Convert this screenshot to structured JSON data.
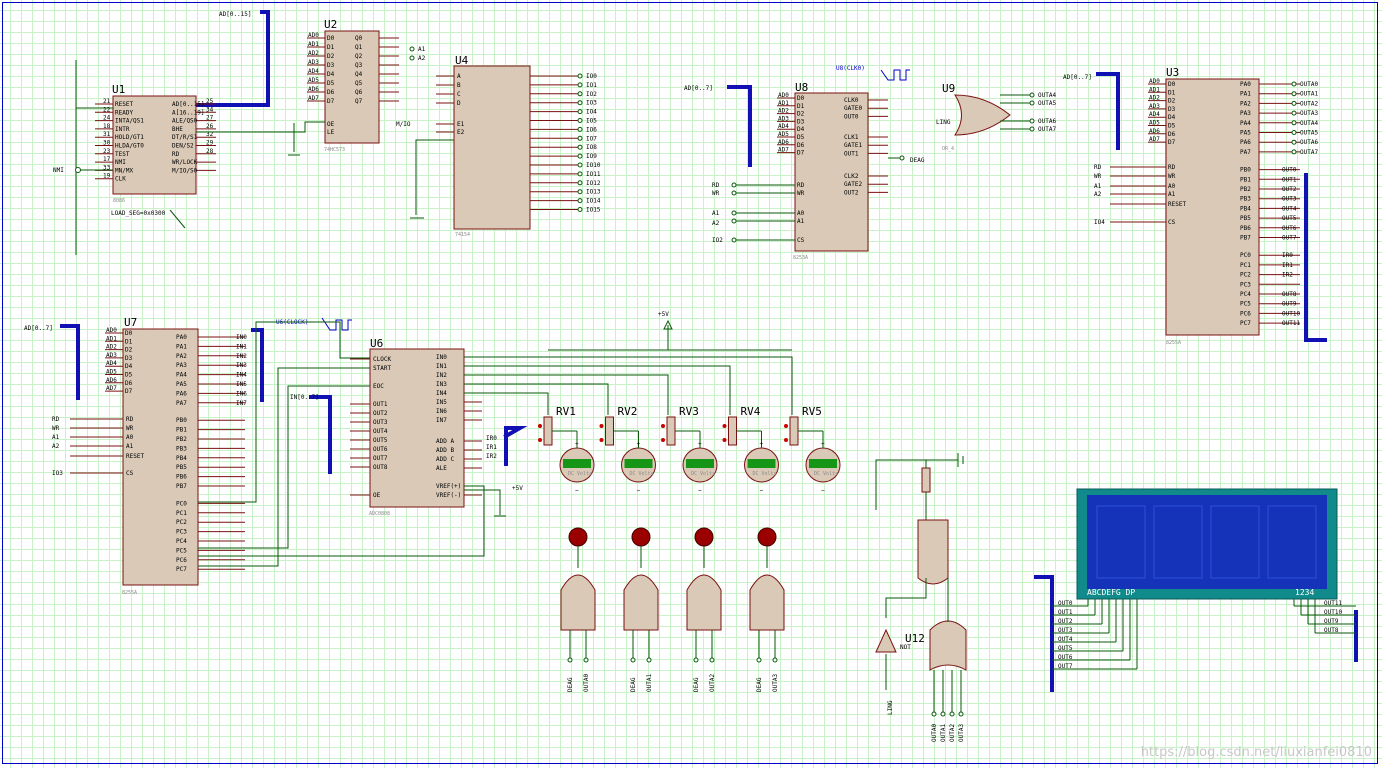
{
  "colors": {
    "grid": "#c9f2c9",
    "wire": "#0a5a0a",
    "bus": "#1010b4",
    "chip": "#d9c9b6",
    "pin": "#7a1111",
    "lcd": "#1433b8"
  },
  "parts": {
    "u1": {
      "ref": "U1",
      "type": "8086",
      "note": "LOAD_SEG=0x0300",
      "left": [
        "RESET",
        "READY",
        "INTA/QS1",
        "INTR",
        "HOLD/GT1",
        "HLDA/GT0",
        "TEST",
        "NMI",
        "MN/MX",
        "CLK"
      ],
      "right": [
        "AD[0..15]",
        "A[16..19]",
        "ALE/QS0",
        "BHE",
        "DT/R/S1",
        "DEN/S2",
        "RD",
        "WR/LOCK",
        "M/IO/S0"
      ],
      "lnum": [
        "21",
        "22",
        "24",
        "18",
        "31",
        "30",
        "23",
        "17",
        "33",
        "19"
      ],
      "rnum": [
        "25",
        "34",
        "27",
        "26",
        "32",
        "29",
        "28"
      ]
    },
    "u2": {
      "ref": "U2",
      "type": "74HC573",
      "pins_l": [
        "D0",
        "D1",
        "D2",
        "D3",
        "D4",
        "D5",
        "D6",
        "D7"
      ],
      "pins_r": [
        "Q0",
        "Q1",
        "Q2",
        "Q3",
        "Q4",
        "Q5",
        "Q6",
        "Q7"
      ],
      "ctl": [
        "OE",
        "LE"
      ],
      "lnet": [
        "AD0",
        "AD1",
        "AD2",
        "AD3",
        "AD4",
        "AD5",
        "AD6",
        "AD7"
      ],
      "rnet": [
        "A1",
        "A2"
      ]
    },
    "u4": {
      "ref": "U4",
      "type": "74154",
      "inputs": [
        "A",
        "B",
        "C",
        "D",
        "E1",
        "E2"
      ],
      "outputs": [
        "IO0",
        "IO1",
        "IO2",
        "IO3",
        "IO4",
        "IO5",
        "IO6",
        "IO7",
        "IO8",
        "IO9",
        "IO10",
        "IO11",
        "IO12",
        "IO13",
        "IO14",
        "IO15"
      ],
      "mio": "M/IO"
    },
    "u8": {
      "ref": "U8",
      "type": "8253A",
      "left": [
        "D0",
        "D1",
        "D2",
        "D3",
        "D4",
        "D5",
        "D6",
        "D7",
        "RD",
        "WR",
        "A0",
        "A1",
        "CS"
      ],
      "right": [
        "CLK0",
        "GATE0",
        "OUT0",
        "CLK1",
        "GATE1",
        "OUT1",
        "CLK2",
        "GATE2",
        "OUT2"
      ],
      "nets": [
        "AD[0..7]",
        "RD",
        "WR",
        "A1",
        "A2",
        "IO2",
        "DEAG"
      ]
    },
    "u9": {
      "ref": "U9",
      "type": "OR_4",
      "outs": [
        "OUTA4",
        "OUTA5",
        "OUTA6",
        "OUTA7"
      ],
      "in": "LING"
    },
    "u3": {
      "ref": "U3",
      "type": "8255A",
      "left": [
        "D0",
        "D1",
        "D2",
        "D3",
        "D4",
        "D5",
        "D6",
        "D7",
        "RD",
        "WR",
        "A0",
        "A1",
        "RESET",
        "CS"
      ],
      "right": [
        "PA0",
        "PA1",
        "PA2",
        "PA3",
        "PA4",
        "PA5",
        "PA6",
        "PA7",
        "PB0",
        "PB1",
        "PB2",
        "PB3",
        "PB4",
        "PB5",
        "PB6",
        "PB7",
        "PC0",
        "PC1",
        "PC2",
        "PC3",
        "PC4",
        "PC5",
        "PC6",
        "PC7"
      ],
      "pa_nets": [
        "OUTA0",
        "OUTA1",
        "OUTA2",
        "OUTA3",
        "OUTA4",
        "OUTA5",
        "OUTA6",
        "OUTA7"
      ],
      "pb_nets": [
        "OUT0",
        "OUT1",
        "OUT2",
        "OUT3",
        "OUT4",
        "OUT5",
        "OUT6",
        "OUT7"
      ],
      "pc_nets": [
        "IR0",
        "IR1",
        "IR2",
        "",
        "OUT8",
        "OUT9",
        "OUT10",
        "OUT11"
      ],
      "io": "IO4"
    },
    "u7": {
      "ref": "U7",
      "type": "8255A",
      "left": [
        "D0",
        "D1",
        "D2",
        "D3",
        "D4",
        "D5",
        "D6",
        "D7",
        "RD",
        "WR",
        "A0",
        "A1",
        "RESET",
        "CS"
      ],
      "right": [
        "PA0",
        "PA1",
        "PA2",
        "PA3",
        "PA4",
        "PA5",
        "PA6",
        "PA7",
        "PB0",
        "PB1",
        "PB2",
        "PB3",
        "PB4",
        "PB5",
        "PB6",
        "PB7",
        "PC0",
        "PC1",
        "PC2",
        "PC3",
        "PC4",
        "PC5",
        "PC6",
        "PC7"
      ],
      "pa_nets": [
        "IN0",
        "IN1",
        "IN2",
        "IN3",
        "IN4",
        "IN5",
        "IN6",
        "IN7"
      ],
      "io": "IO3"
    },
    "u6": {
      "ref": "U6",
      "type": "ADC0808",
      "left": [
        "CLOCK",
        "START",
        "EOC",
        "OUT1",
        "OUT2",
        "OUT3",
        "OUT4",
        "OUT5",
        "OUT6",
        "OUT7",
        "OUT8",
        "OE"
      ],
      "right": [
        "IN0",
        "IN1",
        "IN2",
        "IN3",
        "IN4",
        "IN5",
        "IN6",
        "IN7",
        "ADD A",
        "ADD B",
        "ADD C",
        "ALE",
        "VREF(+)",
        "VREF(-)"
      ],
      "clk": "U6(CLOCK)",
      "in_bus": "IN[0..7]",
      "vref": "+5V"
    },
    "u12": {
      "ref": "U12",
      "type": "NOT",
      "ins": [
        "OUTA0",
        "OUTA1",
        "OUTA2",
        "OUTA3"
      ],
      "ling": "LING"
    },
    "rv": [
      {
        "ref": "RV1",
        "meter": "DC Volts"
      },
      {
        "ref": "RV2",
        "meter": "DC Volts"
      },
      {
        "ref": "RV3",
        "meter": "DC Volts"
      },
      {
        "ref": "RV4",
        "meter": "DC Volts"
      },
      {
        "ref": "RV5",
        "meter": "DC Volts"
      }
    ],
    "and_gates": [
      [
        "DEAG",
        "OUTA0"
      ],
      [
        "DEAG",
        "OUTA1"
      ],
      [
        "DEAG",
        "OUTA2"
      ],
      [
        "DEAG",
        "OUTA3"
      ]
    ],
    "lcd": {
      "seg_label": "ABCDEFG DP",
      "digit_label": "1234",
      "seg_nets": [
        "OUT0",
        "OUT1",
        "OUT2",
        "OUT3",
        "OUT4",
        "OUT5",
        "OUT6",
        "OUT7"
      ],
      "digit_nets": [
        "OUT11",
        "OUT10",
        "OUT9",
        "OUT8"
      ]
    }
  },
  "bus_labels": {
    "ad015": "AD[0..15]",
    "ad07": "AD[0..7]",
    "nmi": "NMI",
    "u8clk": "U8(CLK0)",
    "u6clk": "U6(CLOCK)",
    "vcc": "+5V",
    "in07": "IN[0..7]"
  },
  "watermark": "https://blog.csdn.net/liuxianfei0810"
}
